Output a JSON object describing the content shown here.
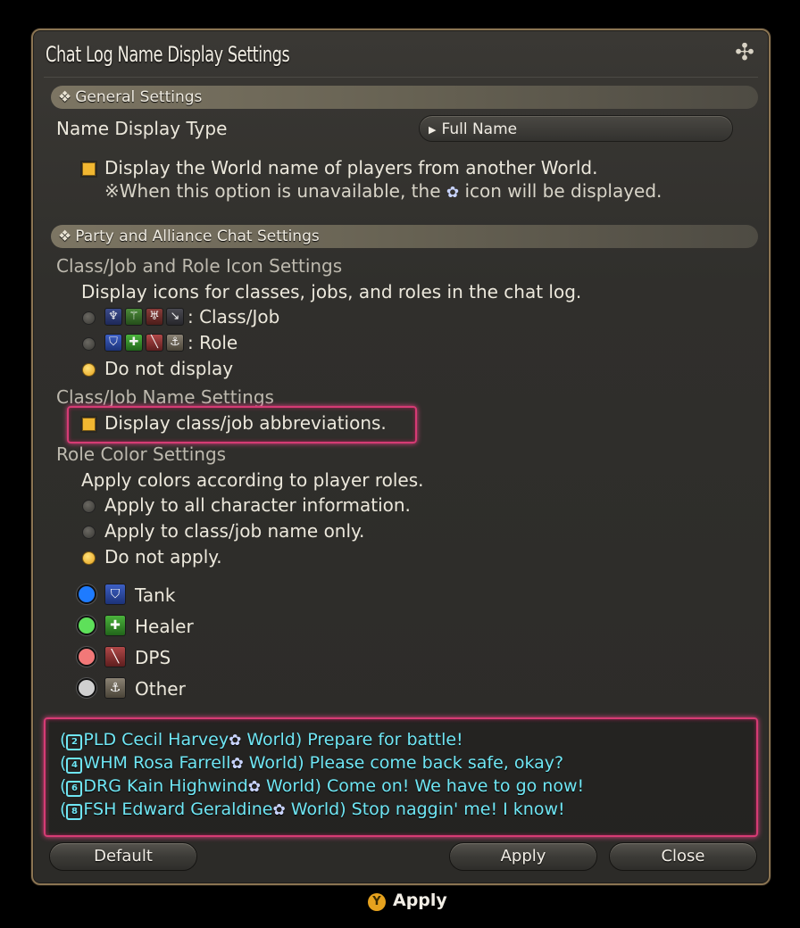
{
  "window": {
    "title": "Chat Log Name Display Settings"
  },
  "general": {
    "header": "General Settings",
    "name_display_label": "Name Display Type",
    "name_display_value": "Full Name",
    "world_checkbox_label": "Display the World name of players from another World.",
    "world_note_before": "※When this option is unavailable, the",
    "world_note_after": "icon will be displayed."
  },
  "party": {
    "header": "Party and Alliance Chat Settings",
    "icon_settings_title": "Class/Job and Role Icon Settings",
    "icon_settings_desc": "Display icons for classes, jobs, and roles in the chat log.",
    "opt_classjob": ": Class/Job",
    "opt_role": ": Role",
    "opt_none": "Do not display",
    "name_settings_title": "Class/Job Name Settings",
    "abbrev_label": "Display class/job abbreviations.",
    "color_settings_title": "Role Color Settings",
    "color_settings_desc": "Apply colors according to player roles.",
    "color_opt_all": "Apply to all character information.",
    "color_opt_name": "Apply to class/job name only.",
    "color_opt_none": "Do not apply."
  },
  "roles": [
    {
      "label": "Tank",
      "color": "#1e7bff"
    },
    {
      "label": "Healer",
      "color": "#5ee05a"
    },
    {
      "label": "DPS",
      "color": "#f27878"
    },
    {
      "label": "Other",
      "color": "#d0d0d0"
    }
  ],
  "preview": [
    {
      "badge": "2",
      "job": "PLD",
      "name": "Cecil Harvey",
      "world": "World",
      "message": "Prepare for battle!"
    },
    {
      "badge": "4",
      "job": "WHM",
      "name": "Rosa Farrell",
      "world": "World",
      "message": "Please come back safe, okay?"
    },
    {
      "badge": "6",
      "job": "DRG",
      "name": "Kain Highwind",
      "world": "World",
      "message": "Come on! We have to go now!"
    },
    {
      "badge": "8",
      "job": "FSH",
      "name": "Edward Geraldine",
      "world": "World",
      "message": "Stop naggin' me! I know!"
    }
  ],
  "buttons": {
    "default": "Default",
    "apply": "Apply",
    "close": "Close"
  },
  "hint": {
    "button": "Y",
    "label": "Apply"
  },
  "colors": {
    "accent": "#f1b731",
    "highlight": "#d63b74",
    "chat": "#6fe6f4"
  }
}
